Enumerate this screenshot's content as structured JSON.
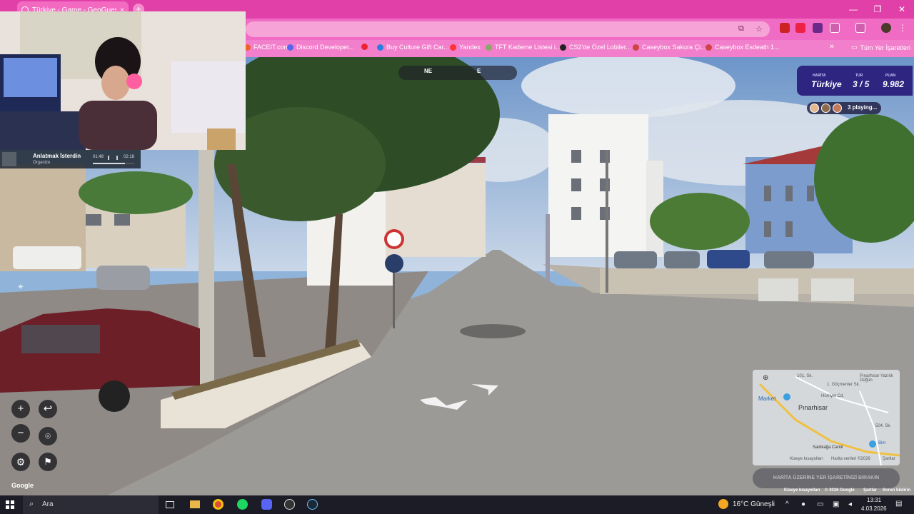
{
  "browser": {
    "tab_title": "Türkiye - Game - GeoGuessr",
    "tab_close": "×",
    "new_tab": "+",
    "minimize": "—",
    "restore": "❐",
    "close": "✕",
    "bookmarks": [
      {
        "label": "FACEIT.com",
        "color": "#f0622b"
      },
      {
        "label": "Discord Developer...",
        "color": "#5865f2"
      },
      {
        "label": "",
        "color": "#e23"
      },
      {
        "label": "Buy Culture Gift Car...",
        "color": "#2a7de1"
      },
      {
        "label": "Yandex",
        "color": "#f33"
      },
      {
        "label": "TFT Kademe Listesi i...",
        "color": "#8a6"
      },
      {
        "label": "CS2'de Özel Lobiler...",
        "color": "#222"
      },
      {
        "label": "Caseybox Sakura Çi...",
        "color": "#c44"
      },
      {
        "label": "Caseybox Esdeath 1...",
        "color": "#c44"
      }
    ],
    "bookmarks_more": "»",
    "all_bookmarks": "Tüm Yer İşaretleri"
  },
  "music": {
    "song": "Anlatmak İsterdin",
    "artist": "Organize",
    "elapsed": "01:48",
    "total": "02:18"
  },
  "compass": {
    "ne": "NE",
    "e": "E"
  },
  "hud": {
    "map_label": "HARİTA",
    "map_value": "Türkiye",
    "round_label": "TUR",
    "round_value": "3 / 5",
    "score_label": "PUAN",
    "score_value": "9.982",
    "players": "3 playing..."
  },
  "controls": {
    "zoom_in": "+",
    "zoom_out": "−",
    "undo": "↩",
    "google": "Google"
  },
  "minimap": {
    "labels": [
      "101. Sk.",
      "1. Göçmenler Sk.",
      "Pınarhisar Yazılık Düğün",
      "Pınarhisar",
      "Market",
      "Hürriyet Cd.",
      "504. Sk.",
      "Sadıkağa Camii",
      "Bim",
      "Klavye kısayolları",
      "Harita verileri ©2026",
      "Şartlar"
    ],
    "guess_button": "HARİTA ÜZERİNE YER İŞARETİNİZİ BIRAKIN"
  },
  "attribution": {
    "shortcuts": "Klavye kısayolları",
    "data": "© 2026 Google",
    "terms": "Şartlar",
    "report": "Sorun bildirin"
  },
  "taskbar": {
    "search": "Ara",
    "weather": "16°C  Güneşli",
    "time": "13:31",
    "date": "4.03.2026"
  }
}
